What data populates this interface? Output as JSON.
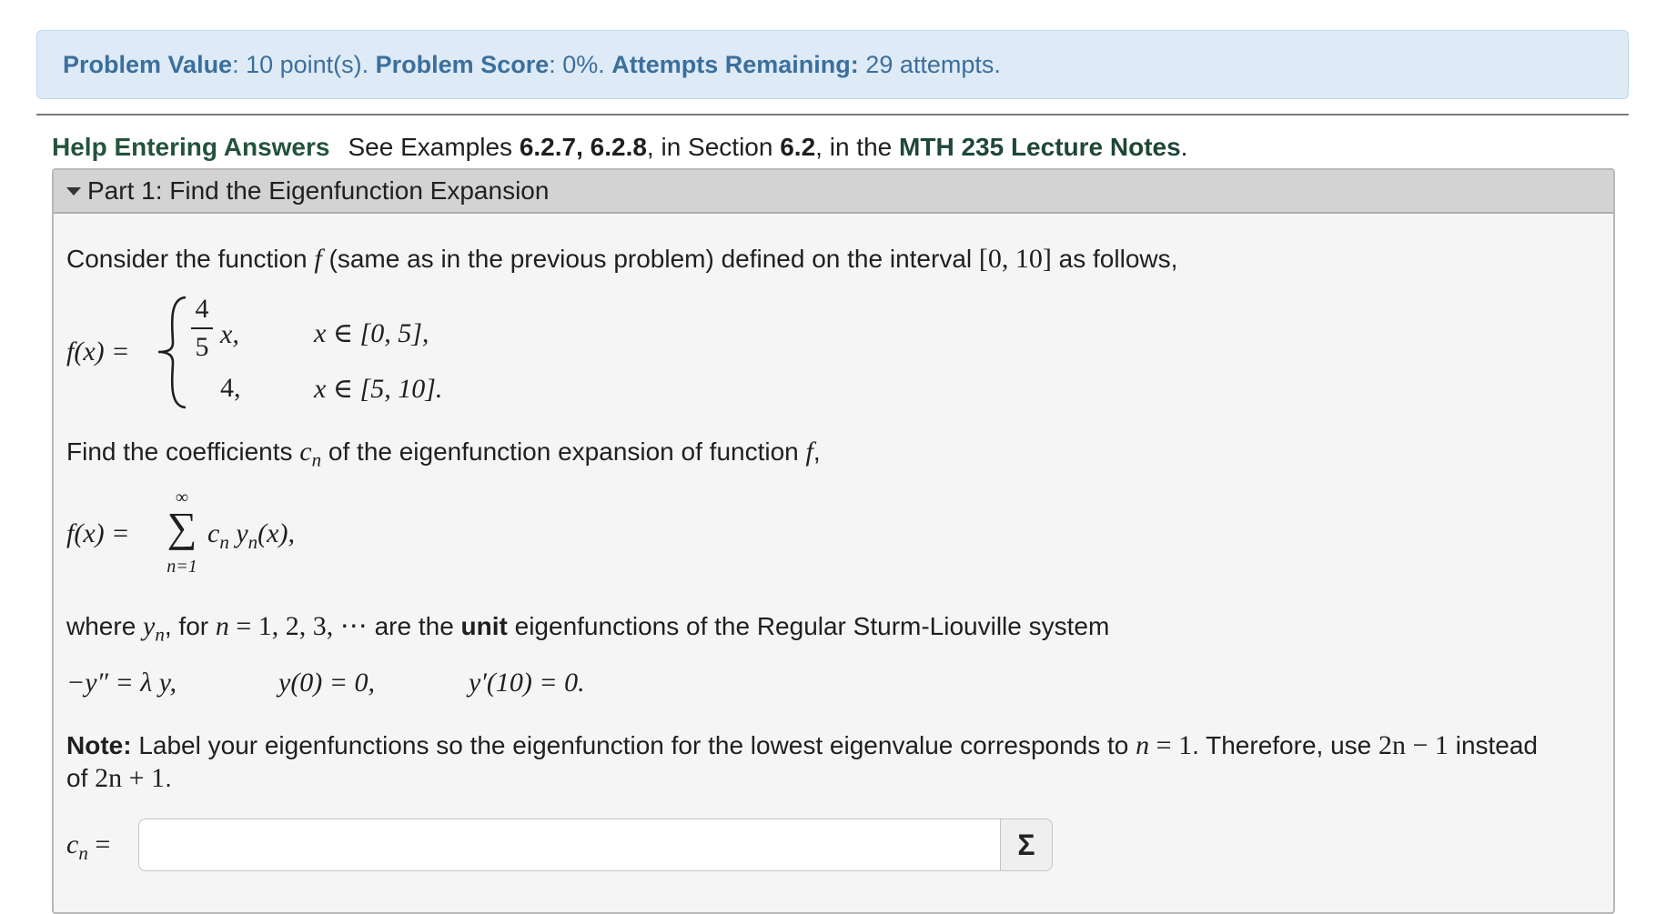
{
  "status": {
    "value_label": "Problem Value",
    "value_text": ": 10 point(s). ",
    "score_label": "Problem Score",
    "score_text": ": 0%. ",
    "attempts_label": "Attempts Remaining:",
    "attempts_text": " 29 attempts."
  },
  "help": {
    "link": "Help Entering Answers",
    "see": "See Examples ",
    "examples": "6.2.7, 6.2.8",
    "in_section": ", in Section ",
    "section": "6.2",
    "in_the": ", in the ",
    "notes": "MTH 235 Lecture Notes",
    "end": "."
  },
  "part": {
    "title": "Part 1: Find the Eigenfunction Expansion"
  },
  "problem": {
    "intro_a": "Consider the function ",
    "f": "f",
    "intro_b": " (same as in the previous problem) defined on the interval ",
    "interval": "[0, 10]",
    "intro_c": " as follows,",
    "piece_lhs": "f(x) =",
    "piece1_num": "4",
    "piece1_den": "5",
    "piece1_x": "x,",
    "piece1_dom": "x ∈ [0, 5],",
    "piece2_val": "4,",
    "piece2_dom": "x ∈ [5, 10].",
    "find_a": "Find the coefficients ",
    "c": "c",
    "n": "n",
    "find_b": " of the eigenfunction expansion of function ",
    "find_c": ",",
    "sum_lhs": "f(x) =",
    "sum_upper": "∞",
    "sum_sigma": "∑",
    "sum_lower": "n=1",
    "sum_term_c": "c",
    "sum_term_n": "n",
    "sum_term_y": " y",
    "sum_term_n2": "n",
    "sum_term_x": "(x),",
    "where_a": "where ",
    "y": "y",
    "where_b": ", for ",
    "where_n": "n",
    "where_eq": " = 1, 2, 3, ⋯",
    "where_c": " are the ",
    "unit": "unit",
    "where_d": " eigenfunctions of the Regular Sturm-Liouville system",
    "ode": "−y″ = λ y,",
    "bc1": "y(0) = 0,",
    "bc2": "y′(10) = 0.",
    "note_label": "Note:",
    "note_a": " Label your eigenfunctions so the eigenfunction for the lowest eigenvalue corresponds to ",
    "note_n": "n",
    "note_eq": " = 1",
    "note_b": ". Therefore, use ",
    "note_2n": "2n − 1",
    "note_c": " instead",
    "note_of": "of ",
    "note_2n1": "2n + 1",
    "note_end": ".",
    "answer_c": "c",
    "answer_n": "n",
    "answer_eq": " ="
  },
  "answer": {
    "value": "",
    "button": "Σ"
  }
}
